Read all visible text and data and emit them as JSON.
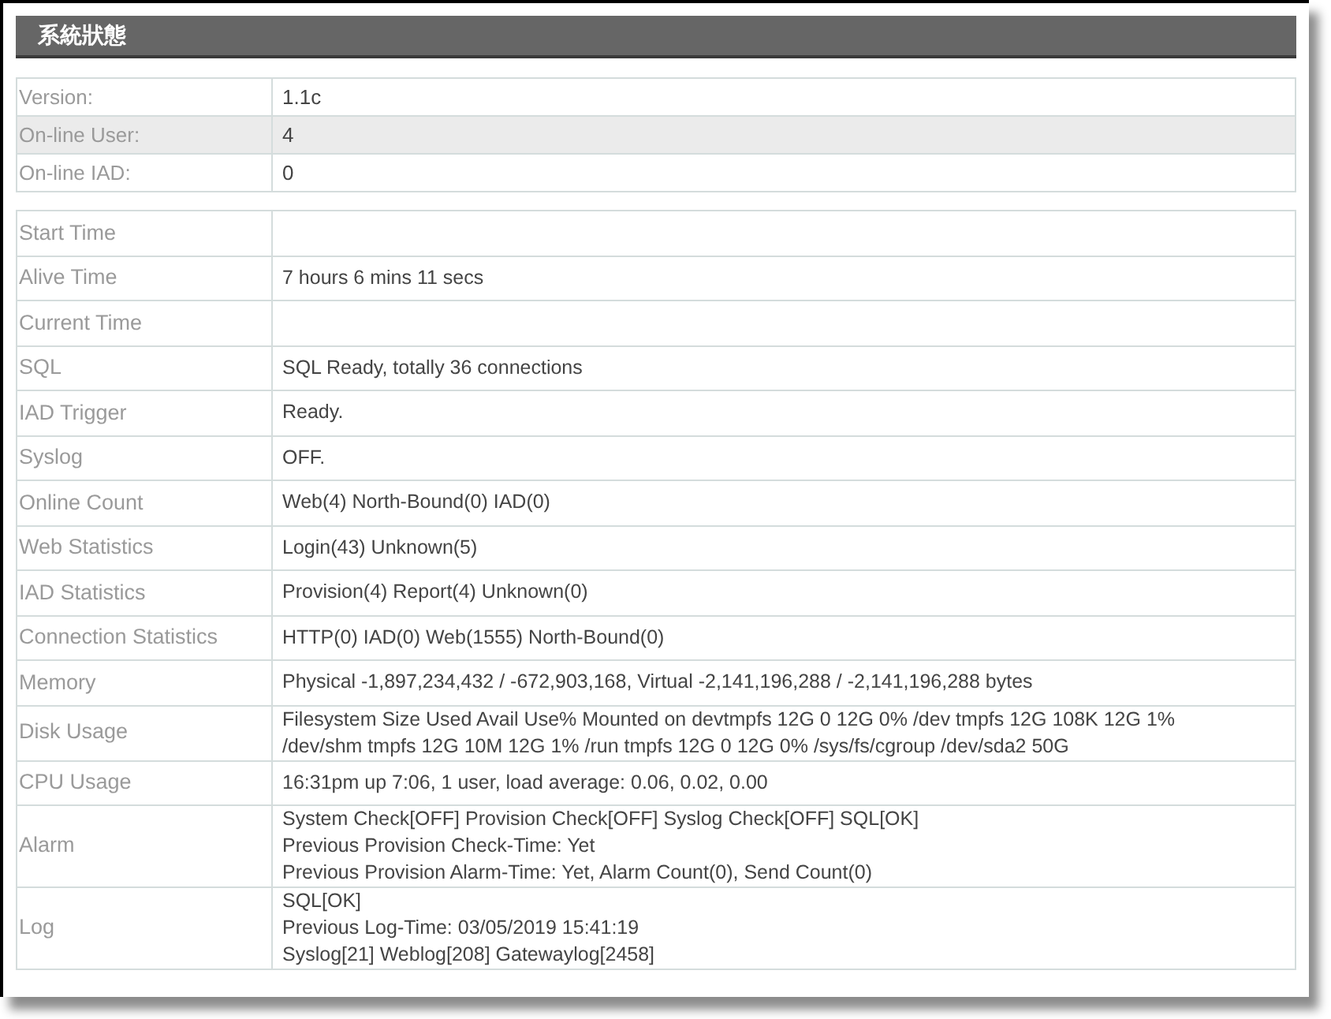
{
  "panel": {
    "title": "系統狀態"
  },
  "summary": [
    {
      "label": "Version:",
      "value": "1.1c",
      "highlighted": false
    },
    {
      "label": "On-line User:",
      "value": "4",
      "highlighted": true
    },
    {
      "label": "On-line IAD:",
      "value": "0",
      "highlighted": false
    }
  ],
  "details": [
    {
      "label": "Start Time"
    },
    {
      "label": "Alive Time",
      "lines": [
        "7 hours 6 mins 11 secs"
      ]
    },
    {
      "label": "Current Time"
    },
    {
      "label": "SQL",
      "lines": [
        "SQL Ready, totally 36 connections"
      ]
    },
    {
      "label": "IAD Trigger",
      "lines": [
        "Ready."
      ]
    },
    {
      "label": "Syslog",
      "lines": [
        "OFF."
      ]
    },
    {
      "label": "Online Count",
      "lines": [
        "Web(4) North-Bound(0) IAD(0)"
      ]
    },
    {
      "label": "Web Statistics",
      "lines": [
        "Login(43) Unknown(5)"
      ]
    },
    {
      "label": "IAD Statistics",
      "lines": [
        "Provision(4) Report(4) Unknown(0)"
      ]
    },
    {
      "label": "Connection Statistics",
      "lines": [
        "HTTP(0) IAD(0) Web(1555) North-Bound(0)"
      ]
    },
    {
      "label": "Memory",
      "lines": [
        "Physical -1,897,234,432 / -672,903,168, Virtual -2,141,196,288 / -2,141,196,288 bytes"
      ]
    },
    {
      "label": "Disk Usage",
      "lines": [
        "Filesystem Size Used Avail Use% Mounted on devtmpfs 12G 0 12G 0% /dev tmpfs 12G 108K 12G 1%",
        "/dev/shm tmpfs 12G 10M 12G 1% /run tmpfs 12G 0 12G 0% /sys/fs/cgroup /dev/sda2 50G"
      ]
    },
    {
      "label": "CPU Usage",
      "lines": [
        "16:31pm up 7:06, 1 user, load average: 0.06, 0.02, 0.00"
      ]
    },
    {
      "label": "Alarm",
      "lines": [
        "System Check[OFF] Provision Check[OFF] Syslog Check[OFF] SQL[OK]",
        "Previous Provision Check-Time: Yet",
        "Previous Provision Alarm-Time: Yet, Alarm Count(0), Send Count(0)"
      ]
    },
    {
      "label": "Log",
      "lines": [
        "SQL[OK]",
        "Previous Log-Time: 03/05/2019 15:41:19",
        "Syslog[21] Weblog[208] Gatewaylog[2458]"
      ]
    }
  ]
}
